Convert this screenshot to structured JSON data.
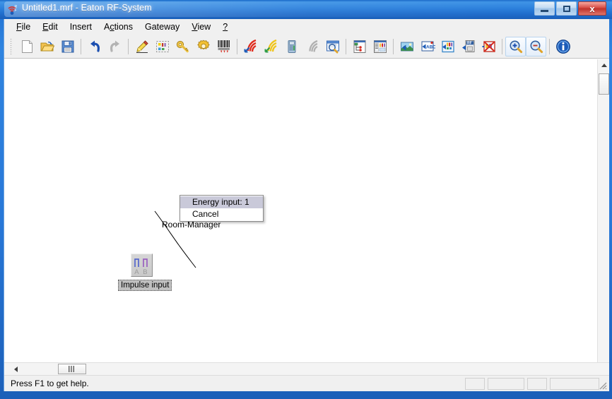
{
  "window": {
    "title": "Untitled1.mrf - Eaton RF-System",
    "app_icon": "rf-antenna-icon",
    "controls": {
      "minimize": "minimize-button",
      "maximize": "maximize-button",
      "close_label": "x"
    }
  },
  "menubar": {
    "items": [
      {
        "label": "File",
        "accel_prefix": "F",
        "accel_rest": "ile"
      },
      {
        "label": "Edit",
        "accel_prefix": "E",
        "accel_rest": "dit"
      },
      {
        "label": "Insert",
        "accel_prefix": "",
        "accel_rest": "Insert"
      },
      {
        "label": "Actions",
        "accel_prefix": "",
        "accel_rest": "Actions"
      },
      {
        "label": "Gateway",
        "accel_prefix": "",
        "accel_rest": "Gateway"
      },
      {
        "label": "View",
        "accel_prefix": "V",
        "accel_rest": "iew"
      },
      {
        "label": "?",
        "accel_prefix": "?",
        "accel_rest": ""
      }
    ]
  },
  "toolbar": {
    "buttons": [
      {
        "name": "new-file-button",
        "icon": "page-icon"
      },
      {
        "name": "open-file-button",
        "icon": "folder-open-icon"
      },
      {
        "name": "save-file-button",
        "icon": "floppy-disk-icon"
      },
      {
        "name": "undo-button",
        "icon": "undo-arrow-icon"
      },
      {
        "name": "redo-button",
        "icon": "redo-arrow-icon"
      },
      {
        "name": "edit-pencil-button",
        "icon": "pencil-icon"
      },
      {
        "name": "select-area-button",
        "icon": "dashed-selection-icon"
      },
      {
        "name": "key-button",
        "icon": "key-icon"
      },
      {
        "name": "settings-button",
        "icon": "gear-icon"
      },
      {
        "name": "barcode-scan-button",
        "icon": "barcode-icon"
      },
      {
        "name": "rf-receive-button",
        "icon": "rf-signal-red-icon"
      },
      {
        "name": "rf-send-button",
        "icon": "rf-signal-yellow-icon"
      },
      {
        "name": "device-button",
        "icon": "handheld-device-icon"
      },
      {
        "name": "rf-idle-button",
        "icon": "rf-signal-grey-icon"
      },
      {
        "name": "window-inspect-button",
        "icon": "window-magnifier-icon"
      },
      {
        "name": "device-tree-button",
        "icon": "device-tree-icon"
      },
      {
        "name": "properties-list-button",
        "icon": "properties-list-icon"
      },
      {
        "name": "import-image-button",
        "icon": "image-import-icon"
      },
      {
        "name": "import-text-button",
        "icon": "abc-import-icon"
      },
      {
        "name": "import-items-button",
        "icon": "items-import-icon"
      },
      {
        "name": "export-rf-button",
        "icon": "rf-export-icon"
      },
      {
        "name": "cancel-transfer-button",
        "icon": "cancel-cross-icon"
      },
      {
        "name": "zoom-in-button",
        "icon": "magnifier-plus-icon"
      },
      {
        "name": "zoom-out-button",
        "icon": "magnifier-minus-icon"
      },
      {
        "name": "about-info-button",
        "icon": "info-icon"
      }
    ]
  },
  "canvas": {
    "devices": [
      {
        "name": "impulse-input-device",
        "label": "Impulse input",
        "channels": [
          {
            "letter": "A",
            "color": "#5566cc"
          },
          {
            "letter": "B",
            "color": "#9a5fbf"
          }
        ]
      }
    ],
    "labels": [
      {
        "name": "room-manager-label",
        "text": "Room-Manager"
      }
    ]
  },
  "context_menu": {
    "items": [
      {
        "label": "Energy input: 1",
        "selected": true
      },
      {
        "label": "Cancel",
        "selected": false
      }
    ]
  },
  "statusbar": {
    "text": "Press F1 to get help.",
    "panels": [
      "",
      "",
      "",
      ""
    ]
  },
  "colors": {
    "titlebar_blue": "#2878d8",
    "close_red": "#d9514a",
    "menu_highlight": "#c9c9d9",
    "selection_grey": "#c0c0c0",
    "canvas_white": "#ffffff"
  }
}
